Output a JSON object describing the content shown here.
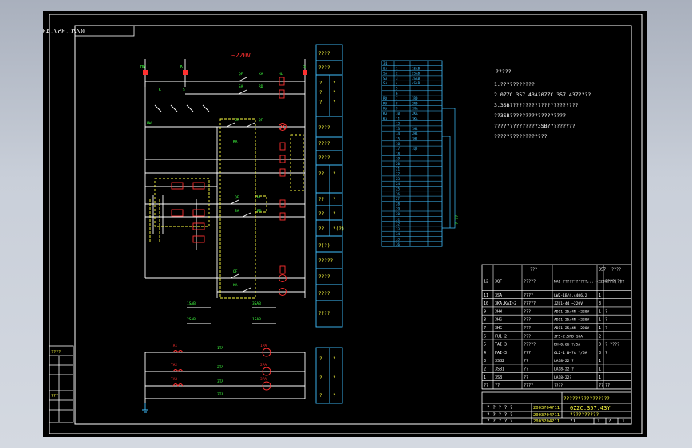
{
  "drawing": {
    "code_mirrored": "0ZZC.357.43Y",
    "voltage": "~220V",
    "colors": {
      "background": "#000000",
      "frame": "#ffffff",
      "wire": "#ffffff",
      "component": "#ff3030",
      "label": "#40ff40",
      "dashed": "#ffff40",
      "table": "#40c0ff",
      "title_yellow": "#ffff40"
    }
  },
  "circuit": {
    "labels": {
      "hw": "HW",
      "k": "K",
      "s": "S",
      "rd": "RD",
      "sa": "SA",
      "qf": "QF",
      "ka": "KA",
      "hl": "HL",
      "s1ab": "1SAB",
      "s2ab": "2SAB",
      "s3ab": "3SAB",
      "pa1": "1PA",
      "pa2": "2PA",
      "pa3": "3PA",
      "ta1": "1TA",
      "ta2": "2TA",
      "ta3": "3TA",
      "t1": "TA1",
      "t2": "TA2",
      "t3": "TA3"
    }
  },
  "function_column": {
    "cells": [
      "????",
      "????",
      "?",
      "?",
      "?",
      "?",
      "????",
      "????",
      "????",
      "??",
      "?",
      "??",
      "?",
      "??",
      "?",
      "??",
      "?(?)",
      "?????",
      "????",
      "????",
      "????"
    ]
  },
  "function_column_lower": {
    "cells": [
      "?",
      "?",
      "?",
      "?",
      "?",
      "?"
    ]
  },
  "terminal_block": {
    "header": "31",
    "rows": [
      [
        "SA",
        "1",
        "1SAB"
      ],
      [
        "SA",
        "2",
        "2SAB"
      ],
      [
        "SA",
        "3",
        "3SAB"
      ],
      [
        "SA",
        "4",
        "4SAB"
      ],
      [
        "",
        "5",
        ""
      ],
      [
        "",
        "6",
        ""
      ],
      [
        "RD",
        "7",
        "1RD"
      ],
      [
        "RD",
        "8",
        "2RD"
      ],
      [
        "KA",
        "9",
        "1KA"
      ],
      [
        "KA",
        "10",
        "2KA"
      ],
      [
        "KA",
        "11",
        "3KA"
      ],
      [
        "",
        "12",
        ""
      ],
      [
        "",
        "13",
        "1HL"
      ],
      [
        "",
        "14",
        "2HL"
      ],
      [
        "",
        "15",
        "3HL"
      ],
      [
        "",
        "16",
        ""
      ],
      [
        "",
        "17",
        "1QF"
      ],
      [
        "",
        "18",
        ""
      ],
      [
        "",
        "19",
        ""
      ],
      [
        "",
        "20",
        ""
      ],
      [
        "",
        "21",
        ""
      ],
      [
        "",
        "22",
        ""
      ],
      [
        "",
        "23",
        ""
      ],
      [
        "",
        "24",
        ""
      ],
      [
        "",
        "25",
        ""
      ],
      [
        "",
        "26",
        ""
      ],
      [
        "",
        "27",
        ""
      ],
      [
        "",
        "28",
        ""
      ],
      [
        "",
        "29",
        ""
      ],
      [
        "",
        "30",
        ""
      ],
      [
        "",
        "31",
        ""
      ],
      [
        "",
        "32",
        ""
      ],
      [
        "",
        "33",
        ""
      ],
      [
        "",
        "34",
        ""
      ],
      [
        "",
        "35",
        ""
      ],
      [
        "",
        "36",
        ""
      ]
    ],
    "side_label": "?  ??"
  },
  "notes": {
    "title": "?????",
    "lines": [
      "1.???????????",
      "2.0ZZC.357.43A?0ZZC.357.43Z????",
      "3.3SB??????????????????????",
      "??3SB??????????????????",
      "??????????????3SB?????????",
      "?????????????????"
    ]
  },
  "bom": {
    "header": [
      "",
      "???",
      "",
      "357",
      "????"
    ],
    "rows": [
      [
        "12",
        "3QF",
        "?????",
        "NAI ???????????,.. ~220V???? ???",
        "",
        "????(?)"
      ],
      [
        "11",
        "3SA",
        "????",
        "LW2-1B/4.4406.2",
        "1",
        ""
      ],
      [
        "10",
        "3KA,KAI~2",
        "?????",
        "JZC1-44  ~220V",
        "3",
        ""
      ],
      [
        "9",
        "3HW",
        "???",
        "AD11-25/4N ~220V",
        "1",
        "?"
      ],
      [
        "8",
        "3HG",
        "???",
        "AD11-25/4N ~220V",
        "1",
        "?"
      ],
      [
        "7",
        "3HG",
        "???",
        "AD11-25/4N ~220V",
        "1",
        "?"
      ],
      [
        "6",
        "FU1~2",
        "???",
        "JF5-2.5RD   10A",
        "2",
        ""
      ],
      [
        "5",
        "TAI~3",
        "?????",
        "BH-0.66 ?/5A",
        "3",
        "? ????"
      ],
      [
        "4",
        "PAI~3",
        "???",
        "6L2-1 0~?A ?/5A",
        "3",
        "?"
      ],
      [
        "3",
        "3SB2",
        "??",
        "LA18-22 ?",
        "1",
        ""
      ],
      [
        "2",
        "3SB1",
        "??",
        "LA18-22 ?",
        "1",
        ""
      ],
      [
        "1",
        "3SB",
        "??",
        "LA18-22?",
        "1",
        ""
      ],
      [
        "??",
        "??",
        "????",
        "????",
        "??",
        "??"
      ]
    ]
  },
  "title_block": {
    "heading": "????????????????",
    "code": "0ZZC.357.43Y",
    "subtitle": "??????????",
    "dates": [
      "2003?04?11",
      "2003?04?11",
      "2003?04?11"
    ],
    "sheet_nums": [
      "?1",
      "1",
      "?",
      "1"
    ]
  },
  "side_stamp": {
    "items": [
      "????",
      "",
      "",
      "???",
      "",
      "",
      ""
    ]
  }
}
